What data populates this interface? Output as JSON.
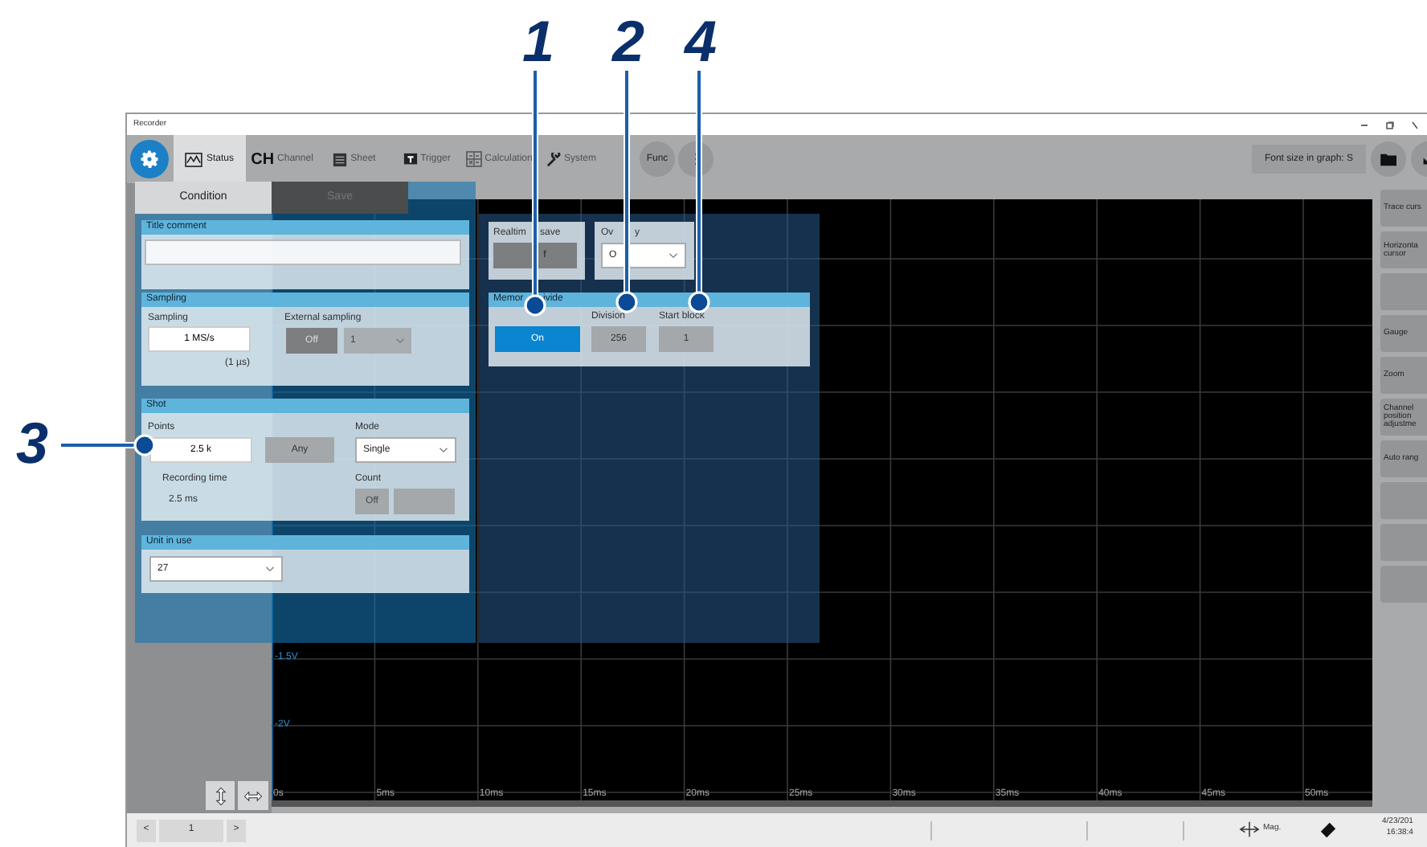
{
  "window": {
    "title": "Recorder"
  },
  "toolbar": {
    "tabs": [
      {
        "kind": "status",
        "label": "Status",
        "selected": true
      },
      {
        "kind": "channel",
        "icon_text": "CH",
        "label": "Channel",
        "selected": false
      },
      {
        "kind": "sheet",
        "label": "Sheet",
        "selected": false
      },
      {
        "kind": "trigger",
        "label": "Trigger",
        "selected": false
      },
      {
        "kind": "calculation",
        "label": "Calculation",
        "selected": false
      },
      {
        "kind": "system",
        "label": "System",
        "selected": false
      }
    ],
    "func_button": "Func",
    "font_size": "Font size in graph: S"
  },
  "sub_tabs": [
    {
      "label": "Condition",
      "selected": true
    },
    {
      "label": "Save",
      "selected": false
    }
  ],
  "title_comment": {
    "title": "Title comment"
  },
  "sampling": {
    "title": "Sampling",
    "sampling_label": "Sampling",
    "sampling_value": "1 MS/s",
    "interval": "(1 µs)",
    "external_label": "External sampling",
    "external_button": "Off",
    "external_select": "1"
  },
  "shot": {
    "title": "Shot",
    "points_label": "Points",
    "points_value": "2.5 k",
    "any_button": "Any",
    "mode_label": "Mode",
    "mode_value": "Single",
    "recording_time_label": "Recording time",
    "recording_time": "2.5 ms",
    "count_label": "Count",
    "count_button": "Off"
  },
  "unit": {
    "title": "Unit in use",
    "value": "27"
  },
  "realtime_save": {
    "label_parts": [
      "Realtim",
      "save"
    ],
    "value": "f"
  },
  "overlay": {
    "label_parts": [
      "Ov",
      "y"
    ],
    "value": "O"
  },
  "memory_divide": {
    "title_parts": [
      "Memor",
      "ivide"
    ],
    "on_button": "On",
    "on": true,
    "division_label": "Division",
    "division": "256",
    "start_block_label": "Start block",
    "start_block": "1"
  },
  "graph": {
    "y_labels": [
      "-1.5V",
      "-2V"
    ],
    "x_labels": [
      "0s",
      "5ms",
      "10ms",
      "15ms",
      "20ms",
      "25ms",
      "30ms",
      "35ms",
      "40ms",
      "45ms",
      "50ms"
    ]
  },
  "side_buttons": [
    {
      "kind": "text",
      "label": "Trace curs"
    },
    {
      "kind": "text",
      "label": "Horizonta cursor"
    },
    {
      "kind": "blank"
    },
    {
      "kind": "text",
      "label": "Gauge"
    },
    {
      "kind": "text",
      "label": "Zoom"
    },
    {
      "kind": "text",
      "label": "Channel position adjustme"
    },
    {
      "kind": "text",
      "label": "Auto rang"
    },
    {
      "kind": "blank"
    },
    {
      "kind": "blank"
    },
    {
      "kind": "blank"
    }
  ],
  "status_bar": {
    "prev": "<",
    "page": "1",
    "next": ">",
    "mag": "Mag.",
    "date": "4/23/201",
    "time": "16:38:4"
  },
  "callouts": [
    {
      "label": "1"
    },
    {
      "label": "2"
    },
    {
      "label": "4"
    },
    {
      "label": "3"
    }
  ]
}
